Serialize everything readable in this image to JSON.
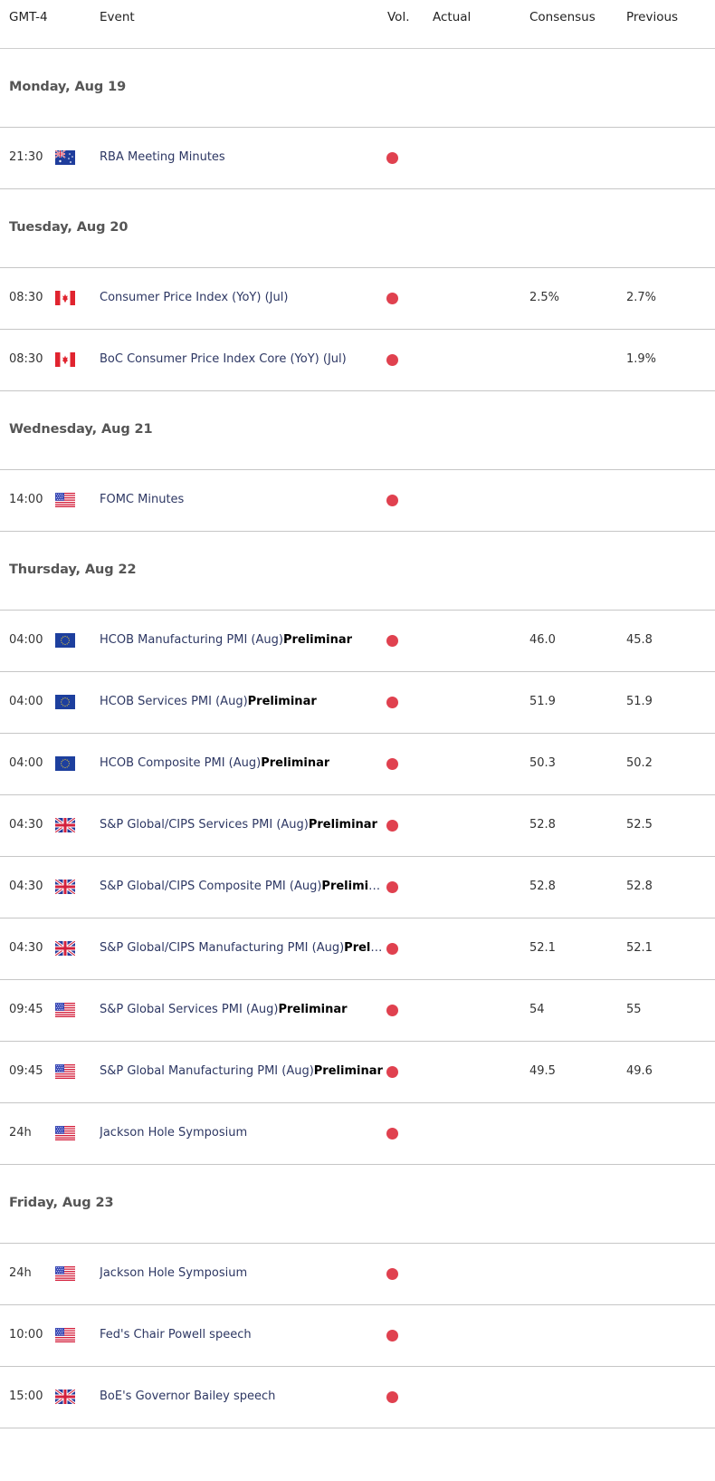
{
  "header": {
    "timezone": "GMT-4",
    "event": "Event",
    "vol": "Vol.",
    "actual": "Actual",
    "consensus": "Consensus",
    "previous": "Previous"
  },
  "colors": {
    "high_volatility": "#e0414f",
    "event_text": "#2d3763"
  },
  "days": [
    {
      "label": "Monday, Aug 19",
      "events": [
        {
          "time": "21:30",
          "flag": "AU",
          "flag_icon": "australia-flag-icon",
          "name": "RBA Meeting Minutes",
          "suffix": "",
          "vol": "high",
          "actual": "",
          "consensus": "",
          "previous": ""
        }
      ]
    },
    {
      "label": "Tuesday, Aug 20",
      "events": [
        {
          "time": "08:30",
          "flag": "CA",
          "flag_icon": "canada-flag-icon",
          "name": "Consumer Price Index (YoY) (Jul)",
          "suffix": "",
          "vol": "high",
          "actual": "",
          "consensus": "2.5%",
          "previous": "2.7%"
        },
        {
          "time": "08:30",
          "flag": "CA",
          "flag_icon": "canada-flag-icon",
          "name": "BoC Consumer Price Index Core (YoY) (Jul)",
          "suffix": "",
          "vol": "high",
          "actual": "",
          "consensus": "",
          "previous": "1.9%"
        }
      ]
    },
    {
      "label": "Wednesday, Aug 21",
      "events": [
        {
          "time": "14:00",
          "flag": "US",
          "flag_icon": "united-states-flag-icon",
          "name": "FOMC Minutes",
          "suffix": "",
          "vol": "high",
          "actual": "",
          "consensus": "",
          "previous": ""
        }
      ]
    },
    {
      "label": "Thursday, Aug 22",
      "events": [
        {
          "time": "04:00",
          "flag": "EU",
          "flag_icon": "european-union-flag-icon",
          "name": "HCOB Manufacturing PMI (Aug)",
          "suffix": "Preliminar",
          "vol": "high",
          "actual": "",
          "consensus": "46.0",
          "previous": "45.8"
        },
        {
          "time": "04:00",
          "flag": "EU",
          "flag_icon": "european-union-flag-icon",
          "name": "HCOB Services PMI (Aug)",
          "suffix": "Preliminar",
          "vol": "high",
          "actual": "",
          "consensus": "51.9",
          "previous": "51.9"
        },
        {
          "time": "04:00",
          "flag": "EU",
          "flag_icon": "european-union-flag-icon",
          "name": "HCOB Composite PMI (Aug)",
          "suffix": "Preliminar",
          "vol": "high",
          "actual": "",
          "consensus": "50.3",
          "previous": "50.2"
        },
        {
          "time": "04:30",
          "flag": "GB",
          "flag_icon": "united-kingdom-flag-icon",
          "name": "S&P Global/CIPS Services PMI (Aug)",
          "suffix": "Preliminar",
          "vol": "high",
          "actual": "",
          "consensus": "52.8",
          "previous": "52.5"
        },
        {
          "time": "04:30",
          "flag": "GB",
          "flag_icon": "united-kingdom-flag-icon",
          "name": "S&P Global/CIPS Composite PMI (Aug)",
          "suffix": "Preliminar",
          "vol": "high",
          "actual": "",
          "consensus": "52.8",
          "previous": "52.8"
        },
        {
          "time": "04:30",
          "flag": "GB",
          "flag_icon": "united-kingdom-flag-icon",
          "name": "S&P Global/CIPS Manufacturing PMI (Aug)",
          "suffix": "Preliminar",
          "vol": "high",
          "actual": "",
          "consensus": "52.1",
          "previous": "52.1"
        },
        {
          "time": "09:45",
          "flag": "US",
          "flag_icon": "united-states-flag-icon",
          "name": "S&P Global Services PMI (Aug)",
          "suffix": "Preliminar",
          "vol": "high",
          "actual": "",
          "consensus": "54",
          "previous": "55"
        },
        {
          "time": "09:45",
          "flag": "US",
          "flag_icon": "united-states-flag-icon",
          "name": "S&P Global Manufacturing PMI (Aug)",
          "suffix": "Preliminar",
          "vol": "high",
          "actual": "",
          "consensus": "49.5",
          "previous": "49.6"
        },
        {
          "time": "24h",
          "flag": "US",
          "flag_icon": "united-states-flag-icon",
          "name": "Jackson Hole Symposium",
          "suffix": "",
          "vol": "high",
          "actual": "",
          "consensus": "",
          "previous": ""
        }
      ]
    },
    {
      "label": "Friday, Aug 23",
      "events": [
        {
          "time": "24h",
          "flag": "US",
          "flag_icon": "united-states-flag-icon",
          "name": "Jackson Hole Symposium",
          "suffix": "",
          "vol": "high",
          "actual": "",
          "consensus": "",
          "previous": ""
        },
        {
          "time": "10:00",
          "flag": "US",
          "flag_icon": "united-states-flag-icon",
          "name": "Fed's Chair Powell speech",
          "suffix": "",
          "vol": "high",
          "actual": "",
          "consensus": "",
          "previous": ""
        },
        {
          "time": "15:00",
          "flag": "GB",
          "flag_icon": "united-kingdom-flag-icon",
          "name": "BoE's Governor Bailey speech",
          "suffix": "",
          "vol": "high",
          "actual": "",
          "consensus": "",
          "previous": ""
        }
      ]
    }
  ]
}
